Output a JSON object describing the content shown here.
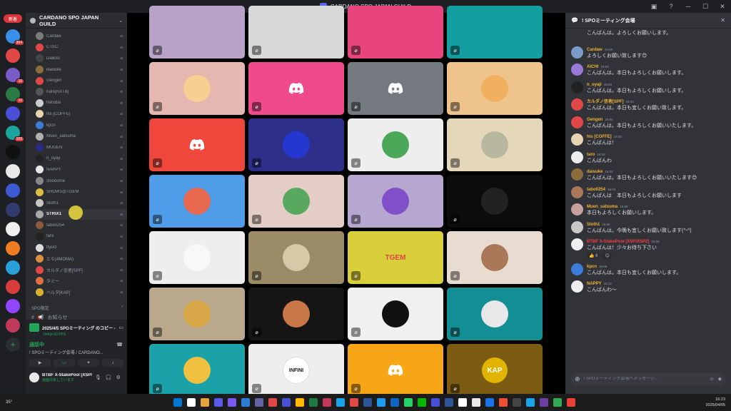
{
  "window": {
    "title": "CARDANO SPO JAPAN GUILD"
  },
  "rail": {
    "home_badge": "新着",
    "servers": [
      {
        "color": "#3a8de8",
        "badge": "364"
      },
      {
        "color": "#e04848",
        "badge": ""
      },
      {
        "color": "#7a5cc9",
        "badge": "10"
      },
      {
        "color": "#2b7a45",
        "badge": "10"
      },
      {
        "color": "#4a4fd8",
        "badge": ""
      },
      {
        "color": "#1ba39c",
        "badge": "109"
      },
      {
        "color": "#111111",
        "badge": ""
      },
      {
        "color": "#e8e8e8",
        "badge": ""
      },
      {
        "color": "#3c5ad1",
        "badge": ""
      },
      {
        "color": "#333a6e",
        "badge": ""
      },
      {
        "color": "#f0f0f0",
        "badge": ""
      },
      {
        "color": "#f07c22",
        "badge": ""
      },
      {
        "color": "#2aa0d8",
        "badge": ""
      },
      {
        "color": "#d83c3c",
        "badge": ""
      },
      {
        "color": "#9146ff",
        "badge": ""
      },
      {
        "color": "#c0395b",
        "badge": ""
      }
    ]
  },
  "sidebar": {
    "guild_name": "CARDANO SPO JAPAN GUILD",
    "members": [
      {
        "name": "Cardaw",
        "color": "#7a7a7a"
      },
      {
        "name": "CTEC",
        "color": "#e04848"
      },
      {
        "name": "Daikoo",
        "color": "#444444"
      },
      {
        "name": "daisuke",
        "color": "#8a6d3b"
      },
      {
        "name": "Gengen",
        "color": "#e04848"
      },
      {
        "name": "haro[RXTB]",
        "color": "#555555"
      },
      {
        "name": "harudai",
        "color": "#cccccc"
      },
      {
        "name": "his [COFFE]",
        "color": "#e8d4b0"
      },
      {
        "name": "kpcn",
        "color": "#3c7bd8"
      },
      {
        "name": "Muen_satsuma",
        "color": "#b0b0b0"
      },
      {
        "name": "MUGEN",
        "color": "#2a2a8a"
      },
      {
        "name": "n_oyaji",
        "color": "#222222"
      },
      {
        "name": "NAPPY",
        "color": "#e8e8e8"
      },
      {
        "name": "shiodome",
        "color": "#888888"
      },
      {
        "name": "SHOW1@TGEM",
        "color": "#d8c040"
      },
      {
        "name": "Sloth1",
        "color": "#c8c8c8"
      },
      {
        "name": "STRIX1",
        "color": "#aaaaaa"
      },
      {
        "name": "tabo0254",
        "color": "#8a5a3a"
      },
      {
        "name": "taro",
        "color": "#222222"
      },
      {
        "name": "ttyorz",
        "color": "#dddddd"
      },
      {
        "name": "とら(4MOMA)",
        "color": "#d89040"
      },
      {
        "name": "カルダノ信者[SPF]",
        "color": "#e04848"
      },
      {
        "name": "タミー",
        "color": "#e07040"
      },
      {
        "name": "ベルダ[KAP]",
        "color": "#d8b030"
      }
    ],
    "category": "SPO限定",
    "announce": "お知らせ",
    "voice": {
      "title": "2025/4/5 SPOミーティング のコピー - G...",
      "sub": "1440p 60 FPS",
      "status": "通話中",
      "channel": "! SPOミーティング会場 / CARDANO..."
    },
    "user": {
      "name": "BTBF X-StakePool [XSP/XS...",
      "status": "画面共有しています"
    }
  },
  "grid": {
    "tiles": [
      {
        "bg": "#b9a2c8",
        "kind": "none"
      },
      {
        "bg": "#d8d8d8",
        "kind": "none"
      },
      {
        "bg": "#e8447e",
        "kind": "none"
      },
      {
        "bg": "#159ea0",
        "kind": "none"
      },
      {
        "bg": "#e4b8b0",
        "kind": "pic",
        "pic": "#f5d090"
      },
      {
        "bg": "#ef4a8c",
        "kind": "discord"
      },
      {
        "bg": "#747a80",
        "kind": "discord"
      },
      {
        "bg": "#efc48c",
        "kind": "pic",
        "pic": "#f0b060"
      },
      {
        "bg": "#f0473c",
        "kind": "discord"
      },
      {
        "bg": "#2d2f88",
        "kind": "pic",
        "pic": "#2438d0"
      },
      {
        "bg": "#eeeeee",
        "kind": "pic",
        "pic": "#4aa858"
      },
      {
        "bg": "#e4d8b8",
        "kind": "pic",
        "pic": "#b8b8a0"
      },
      {
        "bg": "#4f9de8",
        "kind": "pic",
        "pic": "#e86850"
      },
      {
        "bg": "#e4cdc4",
        "kind": "pic",
        "pic": "#58a860"
      },
      {
        "bg": "#b6a6d0",
        "kind": "pic",
        "pic": "#8050c8"
      },
      {
        "bg": "#0c0c0c",
        "kind": "pic",
        "pic": "#222222"
      },
      {
        "bg": "#eeeeee",
        "kind": "pic",
        "pic": "#f8f8f8"
      },
      {
        "bg": "#9a8a66",
        "kind": "pic",
        "pic": "#d8c8a8"
      },
      {
        "bg": "#d8cf3a",
        "kind": "tgem",
        "label": "TGEM"
      },
      {
        "bg": "#e8dcd0",
        "kind": "pic",
        "pic": "#a87858"
      },
      {
        "bg": "#b9a88c",
        "kind": "pic",
        "pic": "#d8a848"
      },
      {
        "bg": "#151515",
        "kind": "pic",
        "pic": "#c87848"
      },
      {
        "bg": "#f0f0f0",
        "kind": "pic",
        "pic": "#111111"
      },
      {
        "bg": "#138e94",
        "kind": "pic",
        "pic": "#e8e8e8"
      },
      {
        "bg": "#1aa2a8",
        "kind": "pic",
        "pic": "#f0c040"
      },
      {
        "bg": "#eeeeee",
        "kind": "infini",
        "label": "INFINI"
      },
      {
        "bg": "#f6a616",
        "kind": "discord"
      },
      {
        "bg": "#7c5c12",
        "kind": "kap",
        "label": "KAP"
      }
    ]
  },
  "chat": {
    "channel": "! SPOミーティング会場",
    "input_placeholder": "! SPOミーティング会場へメッセージ...",
    "messages": [
      {
        "name": "",
        "time": "",
        "text": "こんばんは。よろしくお願いします。",
        "color": "#dbdee1",
        "avatar": "",
        "cont": true
      },
      {
        "name": "Cardaw",
        "time": "16:03",
        "text": "よろしくお願い致します😊",
        "color": "#f0b232",
        "avatar": "#7a9ac8"
      },
      {
        "name": "AICHI",
        "time": "16:03",
        "text": "こんばんは。本日もよろしくお願いします。",
        "color": "#f0b232",
        "avatar": "#9a7ad8"
      },
      {
        "name": "n_oyaji",
        "time": "16:03",
        "text": "こんばんは。本日もよろしくお願いします。",
        "color": "#f0b232",
        "avatar": "#222222"
      },
      {
        "name": "カルダノ信者[SPF]",
        "time": "16:03",
        "text": "こんばんは。本日も宜しくお願い致します。",
        "color": "#f0b232",
        "avatar": "#e04848"
      },
      {
        "name": "Gengen",
        "time": "16:04",
        "text": "こんばんは。本日もよろしくお願いいたします。",
        "color": "#f0b232",
        "avatar": "#e04848"
      },
      {
        "name": "his [COFFE]",
        "time": "16:04",
        "text": "こんばんは！",
        "color": "#f0b232",
        "avatar": "#e8d4b0"
      },
      {
        "name": "taro",
        "time": "16:04",
        "text": "こんばんわ",
        "color": "#f0b232",
        "avatar": "#eeeeee"
      },
      {
        "name": "daisuke",
        "time": "16:04",
        "text": "こんばんは。本日もよろしくお願いいたします😊",
        "color": "#f0b232",
        "avatar": "#8a6d3b"
      },
      {
        "name": "tabo0254",
        "time": "16:04",
        "text": "こんばんは　本日もよろしくお願いします",
        "color": "#f0b232",
        "avatar": "#a87858"
      },
      {
        "name": "Muen_satsuma",
        "time": "16:05",
        "text": "本日もよろしくお願いします。",
        "color": "#f0b232",
        "avatar": "#c8a0a0"
      },
      {
        "name": "Sloth1",
        "time": "16:05",
        "text": "こんばんは。今晩も宜しくお願い致します(^-^)",
        "color": "#f0b232",
        "avatar": "#c8c8c8"
      },
      {
        "name": "BTBF X-StakePool [XSP/XSP2]",
        "time": "16:08",
        "text": "こんばんは！少々お待ち下さい",
        "color": "#f23f43",
        "avatar": "#eeeeee",
        "reactions": [
          "👍 6",
          "😊"
        ]
      },
      {
        "name": "kpcn",
        "time": "16:09",
        "text": "こんばんは。本日も宜しくお願いします。",
        "color": "#f0b232",
        "avatar": "#3c7bd8"
      },
      {
        "name": "NAPPY",
        "time": "16:12",
        "text": "こんばんわ〜",
        "color": "#f0b232",
        "avatar": "#eeeeee"
      }
    ]
  },
  "taskbar": {
    "weather": "35°",
    "time": "16:23",
    "date": "2025/04/05",
    "apps": [
      "#0078d4",
      "#ffffff",
      "#e8a33c",
      "#5a5ae8",
      "#7a5af0",
      "#2e7bd4",
      "#6264a7",
      "#e04848",
      "#4a4fd8",
      "#ffb900",
      "#1e7a45",
      "#c0395b",
      "#1aa3e8",
      "#e04848",
      "#2b579a",
      "#1d9bf0",
      "#0a66c2",
      "#25d366",
      "#00b900",
      "#4a4fd8",
      "#2b579a",
      "#ffffff",
      "#e8e8e8",
      "#1a73e8",
      "#f05032",
      "#444444",
      "#1aa3e8",
      "#6b3fa0",
      "#34a853",
      "#ea4335"
    ]
  }
}
